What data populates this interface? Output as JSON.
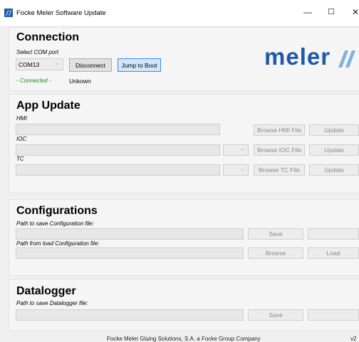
{
  "window": {
    "title": "Focke Meler Software Update",
    "minimize": "—",
    "maximize": "☐",
    "close": "✕"
  },
  "connection": {
    "title": "Connection",
    "select_label": "Select COM port",
    "com_port": "COM13",
    "disconnect_label": "Disconnect",
    "jump_label": "Jump to Boot",
    "status": "- Connected -",
    "device": "Unkown",
    "logo_text": "meler"
  },
  "app_update": {
    "title": "App Update",
    "hmi_label": "HMI",
    "ioc_label": "IOC",
    "tc_label": "TC",
    "browse_hmi": "Browse HMI File",
    "browse_ioc": "Browse IOC File",
    "browse_tc": "Browse TC File",
    "update": "Update"
  },
  "configurations": {
    "title": "Configurations",
    "save_path_label": "Path to save Configuration file:",
    "load_path_label": "Path from load Configuration file:",
    "save": "Save",
    "browse": "Browse",
    "load": "Load"
  },
  "datalogger": {
    "title": "Datalogger",
    "save_path_label": "Path to save Datalogger file:",
    "save": "Save"
  },
  "footer": {
    "company": "Focke Meler Gluing Solutions, S.A. a Focke Group Company",
    "version": "v2"
  },
  "colors": {
    "logo_blue": "#1e5aa8",
    "logo_light": "#7fb3e0",
    "connected_green": "#1a8a1a",
    "accent_blue": "#3c8fdc"
  }
}
